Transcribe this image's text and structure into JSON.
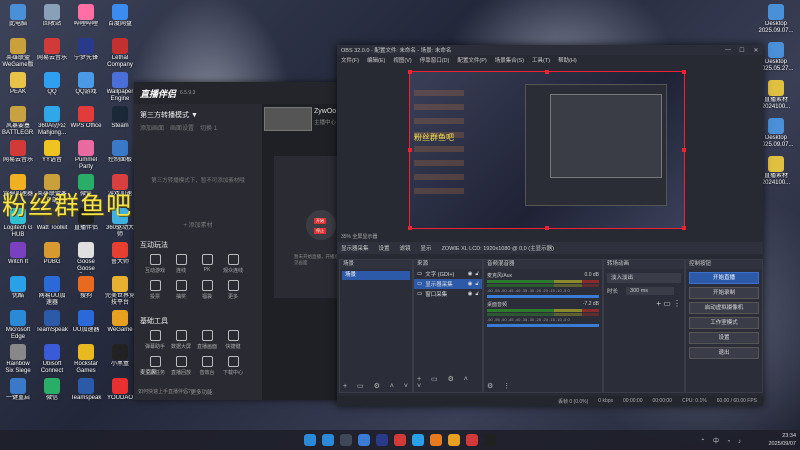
{
  "desktop": {
    "icons_left": [
      {
        "label": "此电脑",
        "color": "#4a90d9"
      },
      {
        "label": "回收站",
        "color": "#8aa0b8"
      },
      {
        "label": "哔哩哔哩",
        "color": "#ff6fa3"
      },
      {
        "label": "百度网盘",
        "color": "#3b8cf0"
      },
      {
        "label": "英雄联盟WeGame版",
        "color": "#c9a03a"
      },
      {
        "label": "网易云音乐",
        "color": "#d23a3a"
      },
      {
        "label": "宁梦先锋",
        "color": "#2a3a8a"
      },
      {
        "label": "Lethal Company",
        "color": "#c23030"
      },
      {
        "label": "PEAK",
        "color": "#e8c34a"
      },
      {
        "label": "QQ",
        "color": "#2fa0f0"
      },
      {
        "label": "QQ游戏",
        "color": "#4a9ae8"
      },
      {
        "label": "Wallpaper Engine",
        "color": "#4a70d8"
      },
      {
        "label": "风暴要塞BATTLEGR...",
        "color": "#c8a240"
      },
      {
        "label": "360AI办公Mahjong...",
        "color": "#2ea8e8"
      },
      {
        "label": "WPS Office",
        "color": "#e23b3b"
      },
      {
        "label": "Steam",
        "color": "#1b2838"
      },
      {
        "label": "网易云音乐",
        "color": "#d23a3a"
      },
      {
        "label": "YY语音",
        "color": "#f0c420"
      },
      {
        "label": "Pummel Party",
        "color": "#e86aa0"
      },
      {
        "label": "控制面板",
        "color": "#3a78c8"
      },
      {
        "label": "雷神加速器",
        "color": "#f0b020"
      },
      {
        "label": "英雄联盟客户端",
        "color": "#c9a03a"
      },
      {
        "label": "微信",
        "color": "#2aae67"
      },
      {
        "label": "游戏加速",
        "color": "#d84040"
      },
      {
        "label": "Logitech G HUB",
        "color": "#30c0d0"
      },
      {
        "label": "Watt Toolkit",
        "color": "#3a3a3a"
      },
      {
        "label": "直播伴侣",
        "color": "#202020"
      },
      {
        "label": "360驱动大师",
        "color": "#40b0e0"
      },
      {
        "label": "Witch It",
        "color": "#7a40c0"
      },
      {
        "label": "PUBG",
        "color": "#d89a30"
      },
      {
        "label": "Goose Goose Duck",
        "color": "#e0e0e0"
      },
      {
        "label": "鲁大师",
        "color": "#e84030"
      },
      {
        "label": "优酷",
        "color": "#2aa0e8"
      },
      {
        "label": "网易UU加速器",
        "color": "#2a6ad8"
      },
      {
        "label": "搜狗",
        "color": "#e86a20"
      },
      {
        "label": "完美世界竞技平台",
        "color": "#e8b030"
      },
      {
        "label": "Microsoft Edge",
        "color": "#2a8ad8"
      },
      {
        "label": "TeamSpeak",
        "color": "#2a5aa8"
      },
      {
        "label": "UU加速器",
        "color": "#2a6ad8"
      },
      {
        "label": "WeGame",
        "color": "#e8a020"
      },
      {
        "label": "Rainbow Six Siege",
        "color": "#888888"
      },
      {
        "label": "Ubisoft Connect",
        "color": "#3a5ad8"
      },
      {
        "label": "Rockstar Games",
        "color": "#e8b820"
      },
      {
        "label": "小黑盒",
        "color": "#222222"
      },
      {
        "label": "一键重启",
        "color": "#3a78c8"
      },
      {
        "label": "微信",
        "color": "#2aae67"
      },
      {
        "label": "Teamspeak",
        "color": "#2a5aa8"
      },
      {
        "label": "YOUDAO",
        "color": "#e83030"
      }
    ],
    "icons_right": [
      {
        "label": "Desktop 2025.09.07...",
        "color": "#4a90d9"
      },
      {
        "label": "Desktop 2025.05.27...",
        "color": "#4a90d9"
      },
      {
        "label": "直播素材 2024100...",
        "color": "#e0c040"
      },
      {
        "label": "Desktop 2025.09.07...",
        "color": "#4a90d9"
      },
      {
        "label": "直播素材 2024100...",
        "color": "#e0c040"
      }
    ],
    "overlay_text": "粉丝群鱼吧"
  },
  "zhibo": {
    "title": "直播伴侣",
    "version": "6.5.9.3",
    "scene_mode": "第三方转播模式 ▼",
    "filters": [
      "添加画面",
      "画面设置",
      "切换 1"
    ],
    "empty_hint": "第三方转播模式下，暂不可添加素材哦",
    "add_material": "+ 添加素材",
    "section_interact": "互动玩法",
    "interact_items": [
      "互动游戏",
      "连线",
      "PK",
      "观众连线",
      "投票",
      "抽奖",
      "福袋",
      "更多"
    ],
    "section_tools": "基础工具",
    "tool_items": [
      "弹幕助手",
      "数据大屏",
      "直播画面",
      "快捷键",
      "主播任务",
      "直播回放",
      "音效台",
      "下载中心"
    ],
    "more_features": "··· 更多功能",
    "user_name": "ZywOo",
    "user_sub": "主播中心",
    "stage_btn1": "开始",
    "stage_btn2": "停止",
    "stage_hint": "暂未开始直播，开播后可见画面",
    "volume_label": "麦克风",
    "help": "如何快速上手直播伴侣?"
  },
  "obs": {
    "title": "OBS 32.0.0 - 配置文件: 未命名 - 场景: 未命名",
    "menu": [
      "文件(F)",
      "编辑(E)",
      "视图(V)",
      "停靠窗口(D)",
      "配置文件(P)",
      "场景集合(S)",
      "工具(T)",
      "帮助(H)"
    ],
    "zoom": "35%",
    "preview_hint": "全屏显示器",
    "source_bar": {
      "selected": "显示器采集",
      "settings": "设置",
      "filters": "滤镜",
      "display_label": "显示",
      "display_value": "ZOWIE XL LCD: 1920x1080 @ 0,0 (主显示器)"
    },
    "docks": {
      "scenes": "场景",
      "sources": "来源",
      "mixer": "音频混音器",
      "transitions": "转场动画",
      "controls": "控制按钮"
    },
    "scene_item": "场景",
    "sources": [
      {
        "name": "文字 (GDI+)",
        "selected": false
      },
      {
        "name": "显示器采集",
        "selected": true
      },
      {
        "name": "窗口采集",
        "selected": false
      }
    ],
    "mixer": [
      {
        "name": "麦克风/Aux",
        "db": "0.0 dB"
      },
      {
        "name": "桌面音频",
        "db": "-7.2 dB"
      }
    ],
    "meter_scale": "-60 -55 -50 -45 -40 -35 -30 -25 -20 -15 -10 -5 0",
    "transition": {
      "type": "淡入淡出",
      "duration_label": "时长",
      "duration_value": "300 ms"
    },
    "controls": [
      {
        "label": "开始直播",
        "primary": true
      },
      {
        "label": "开始录制",
        "primary": false
      },
      {
        "label": "启动虚拟摄像机",
        "primary": false
      },
      {
        "label": "工作室模式",
        "primary": false
      },
      {
        "label": "设置",
        "primary": false
      },
      {
        "label": "退出",
        "primary": false
      }
    ],
    "status": [
      "丢帧 0 (0.0%)",
      "0 kbps",
      "00:00:00",
      "00:00:00",
      "CPU: 0.1%",
      "60.00 / 60.00 FPS"
    ]
  },
  "taskbar": {
    "apps": [
      "#2a8ad8",
      "#404858",
      "#3a7bd5",
      "#2a3a8a",
      "#d23a3a",
      "#2aa0e8",
      "#e87a20",
      "#e8a020",
      "#d23a3a",
      "#202020"
    ],
    "time": "23:34",
    "date": "2025/09/07"
  }
}
